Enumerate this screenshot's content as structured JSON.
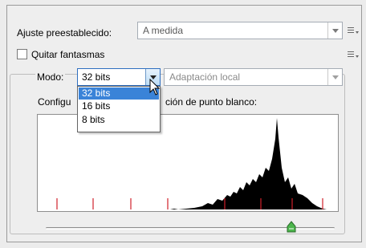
{
  "preset": {
    "label": "Ajuste preestablecido:",
    "value": "A medida"
  },
  "remove_ghosts": {
    "label": "Quitar fantasmas",
    "checked": false
  },
  "mode": {
    "label": "Modo:",
    "selected": "32 bits",
    "options": [
      "32 bits",
      "16 bits",
      "8 bits"
    ],
    "highlighted_index": 0
  },
  "method": {
    "value": "Adaptación local"
  },
  "white_point": {
    "label": "Configuración de punto blanco:",
    "visible_prefix": "Configu",
    "visible_suffix": "ción de punto blanco:"
  },
  "histogram": {
    "slider_value": 0.86
  },
  "icons": [
    "panel-menu-icon",
    "dropdown-arrow-icon",
    "mouse-cursor-icon",
    "slider-thumb-icon"
  ],
  "colors": {
    "selection": "#3a83d8",
    "focus_border": "#2f6fc0",
    "stop_marks": "#d0202a"
  }
}
